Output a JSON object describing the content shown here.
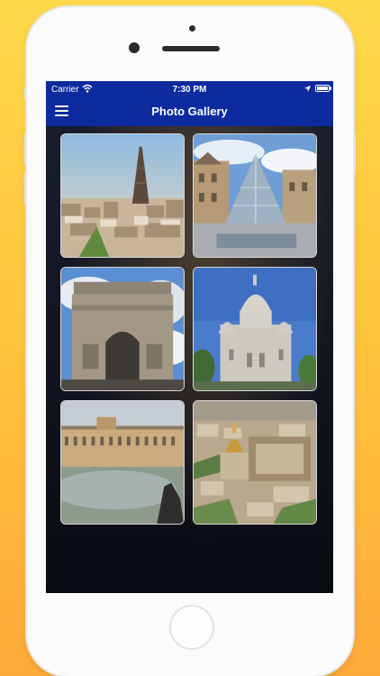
{
  "status_bar": {
    "carrier": "Carrier",
    "time": "7:30 PM",
    "icons": [
      "wifi-icon",
      "location-icon",
      "battery-icon"
    ]
  },
  "nav_bar": {
    "title": "Photo Gallery",
    "menu_icon": "hamburger-menu-icon"
  },
  "gallery": {
    "photos": [
      {
        "subject": "eiffel-tower-view"
      },
      {
        "subject": "louvre-pyramid"
      },
      {
        "subject": "arc-de-triomphe"
      },
      {
        "subject": "sacre-coeur-basilica"
      },
      {
        "subject": "palace-of-versailles"
      },
      {
        "subject": "les-invalides-aerial"
      }
    ]
  },
  "colors": {
    "bar_blue": "#0d2a9e",
    "background_top": "#ffd94a",
    "background_bottom": "#ffab3a"
  }
}
